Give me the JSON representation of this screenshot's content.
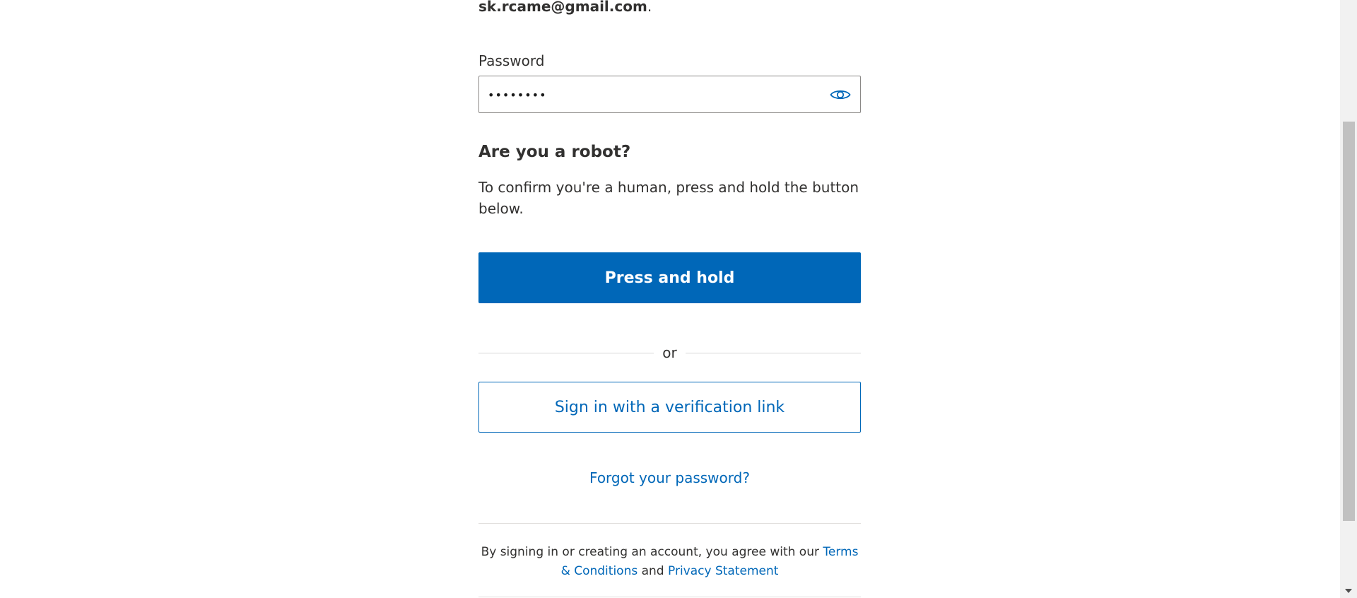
{
  "account": {
    "email": "sk.rcame@gmail.com",
    "email_suffix": "."
  },
  "password": {
    "label": "Password",
    "value": "••••••••",
    "show_icon": "eye-icon"
  },
  "robot_check": {
    "heading": "Are you a robot?",
    "instructions": "To confirm you're a human, press and hold the button below.",
    "button_label": "Press and hold"
  },
  "divider_text": "or",
  "verification": {
    "button_label": "Sign in with a verification link"
  },
  "forgot_password": {
    "label": "Forgot your password?"
  },
  "terms": {
    "prefix": "By signing in or creating an account, you agree with our ",
    "terms_link": "Terms & Conditions",
    "conjunction": " and ",
    "privacy_link": "Privacy Statement"
  },
  "colors": {
    "accent": "#0067b8",
    "text": "#323130",
    "border": "#8a8886"
  }
}
